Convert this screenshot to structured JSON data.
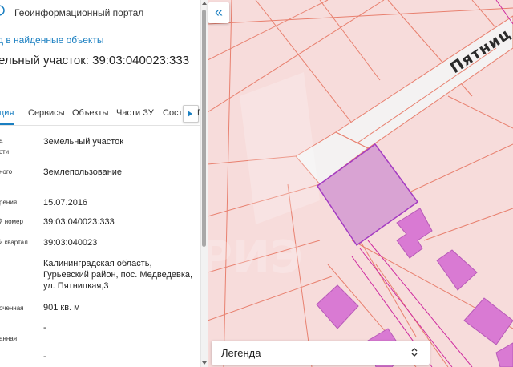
{
  "header": {
    "title": "Геоинформационный портал"
  },
  "nav": {
    "back_label": "д в найденные объекты"
  },
  "parcel": {
    "title": "ельный участок: 39:03:040023:333"
  },
  "tabs": [
    {
      "label": "ция",
      "active": true
    },
    {
      "label": "Сервисы"
    },
    {
      "label": "Объекты"
    },
    {
      "label": "Части ЗУ"
    },
    {
      "label": "Соста"
    }
  ],
  "tabs_overflow": "Г",
  "properties": [
    {
      "label_lines": [
        "а",
        "сти"
      ],
      "value_lines": [
        "Земельный участок"
      ]
    },
    {
      "label_lines": [
        "ного"
      ],
      "value_lines": [
        "Землепользование"
      ]
    },
    {
      "label_lines": [
        "рения"
      ],
      "value_lines": [
        "15.07.2016"
      ]
    },
    {
      "label_lines": [
        "й номер"
      ],
      "value_lines": [
        "39:03:040023:333"
      ]
    },
    {
      "label_lines": [
        "й квартал"
      ],
      "value_lines": [
        "39:03:040023"
      ]
    },
    {
      "label_lines": [],
      "value_lines": [
        "Калининградская область,",
        "Гурьевский район, пос. Медведевка,",
        "ул. Пятницкая,3"
      ]
    },
    {
      "label_lines": [
        "оченная"
      ],
      "value_lines": [
        "901 кв. м"
      ]
    },
    {
      "label_lines": [
        "анная"
      ],
      "value_lines": [
        "-"
      ]
    },
    {
      "label_lines": [],
      "value_lines": [
        "-"
      ]
    }
  ],
  "map": {
    "street_name": "Пятниц",
    "legend_label": "Легенда",
    "collapse_icon": "double-chevron-left-icon",
    "colors": {
      "background": "#f7dcdb",
      "parcel_line": "#e8806f",
      "selected_fill": "#d9a3d3",
      "selected_stroke": "#a43cc2",
      "building_fill": "#d97ad3",
      "road_fill": "#f4f2f2",
      "accent": "#1a7fc1"
    }
  }
}
